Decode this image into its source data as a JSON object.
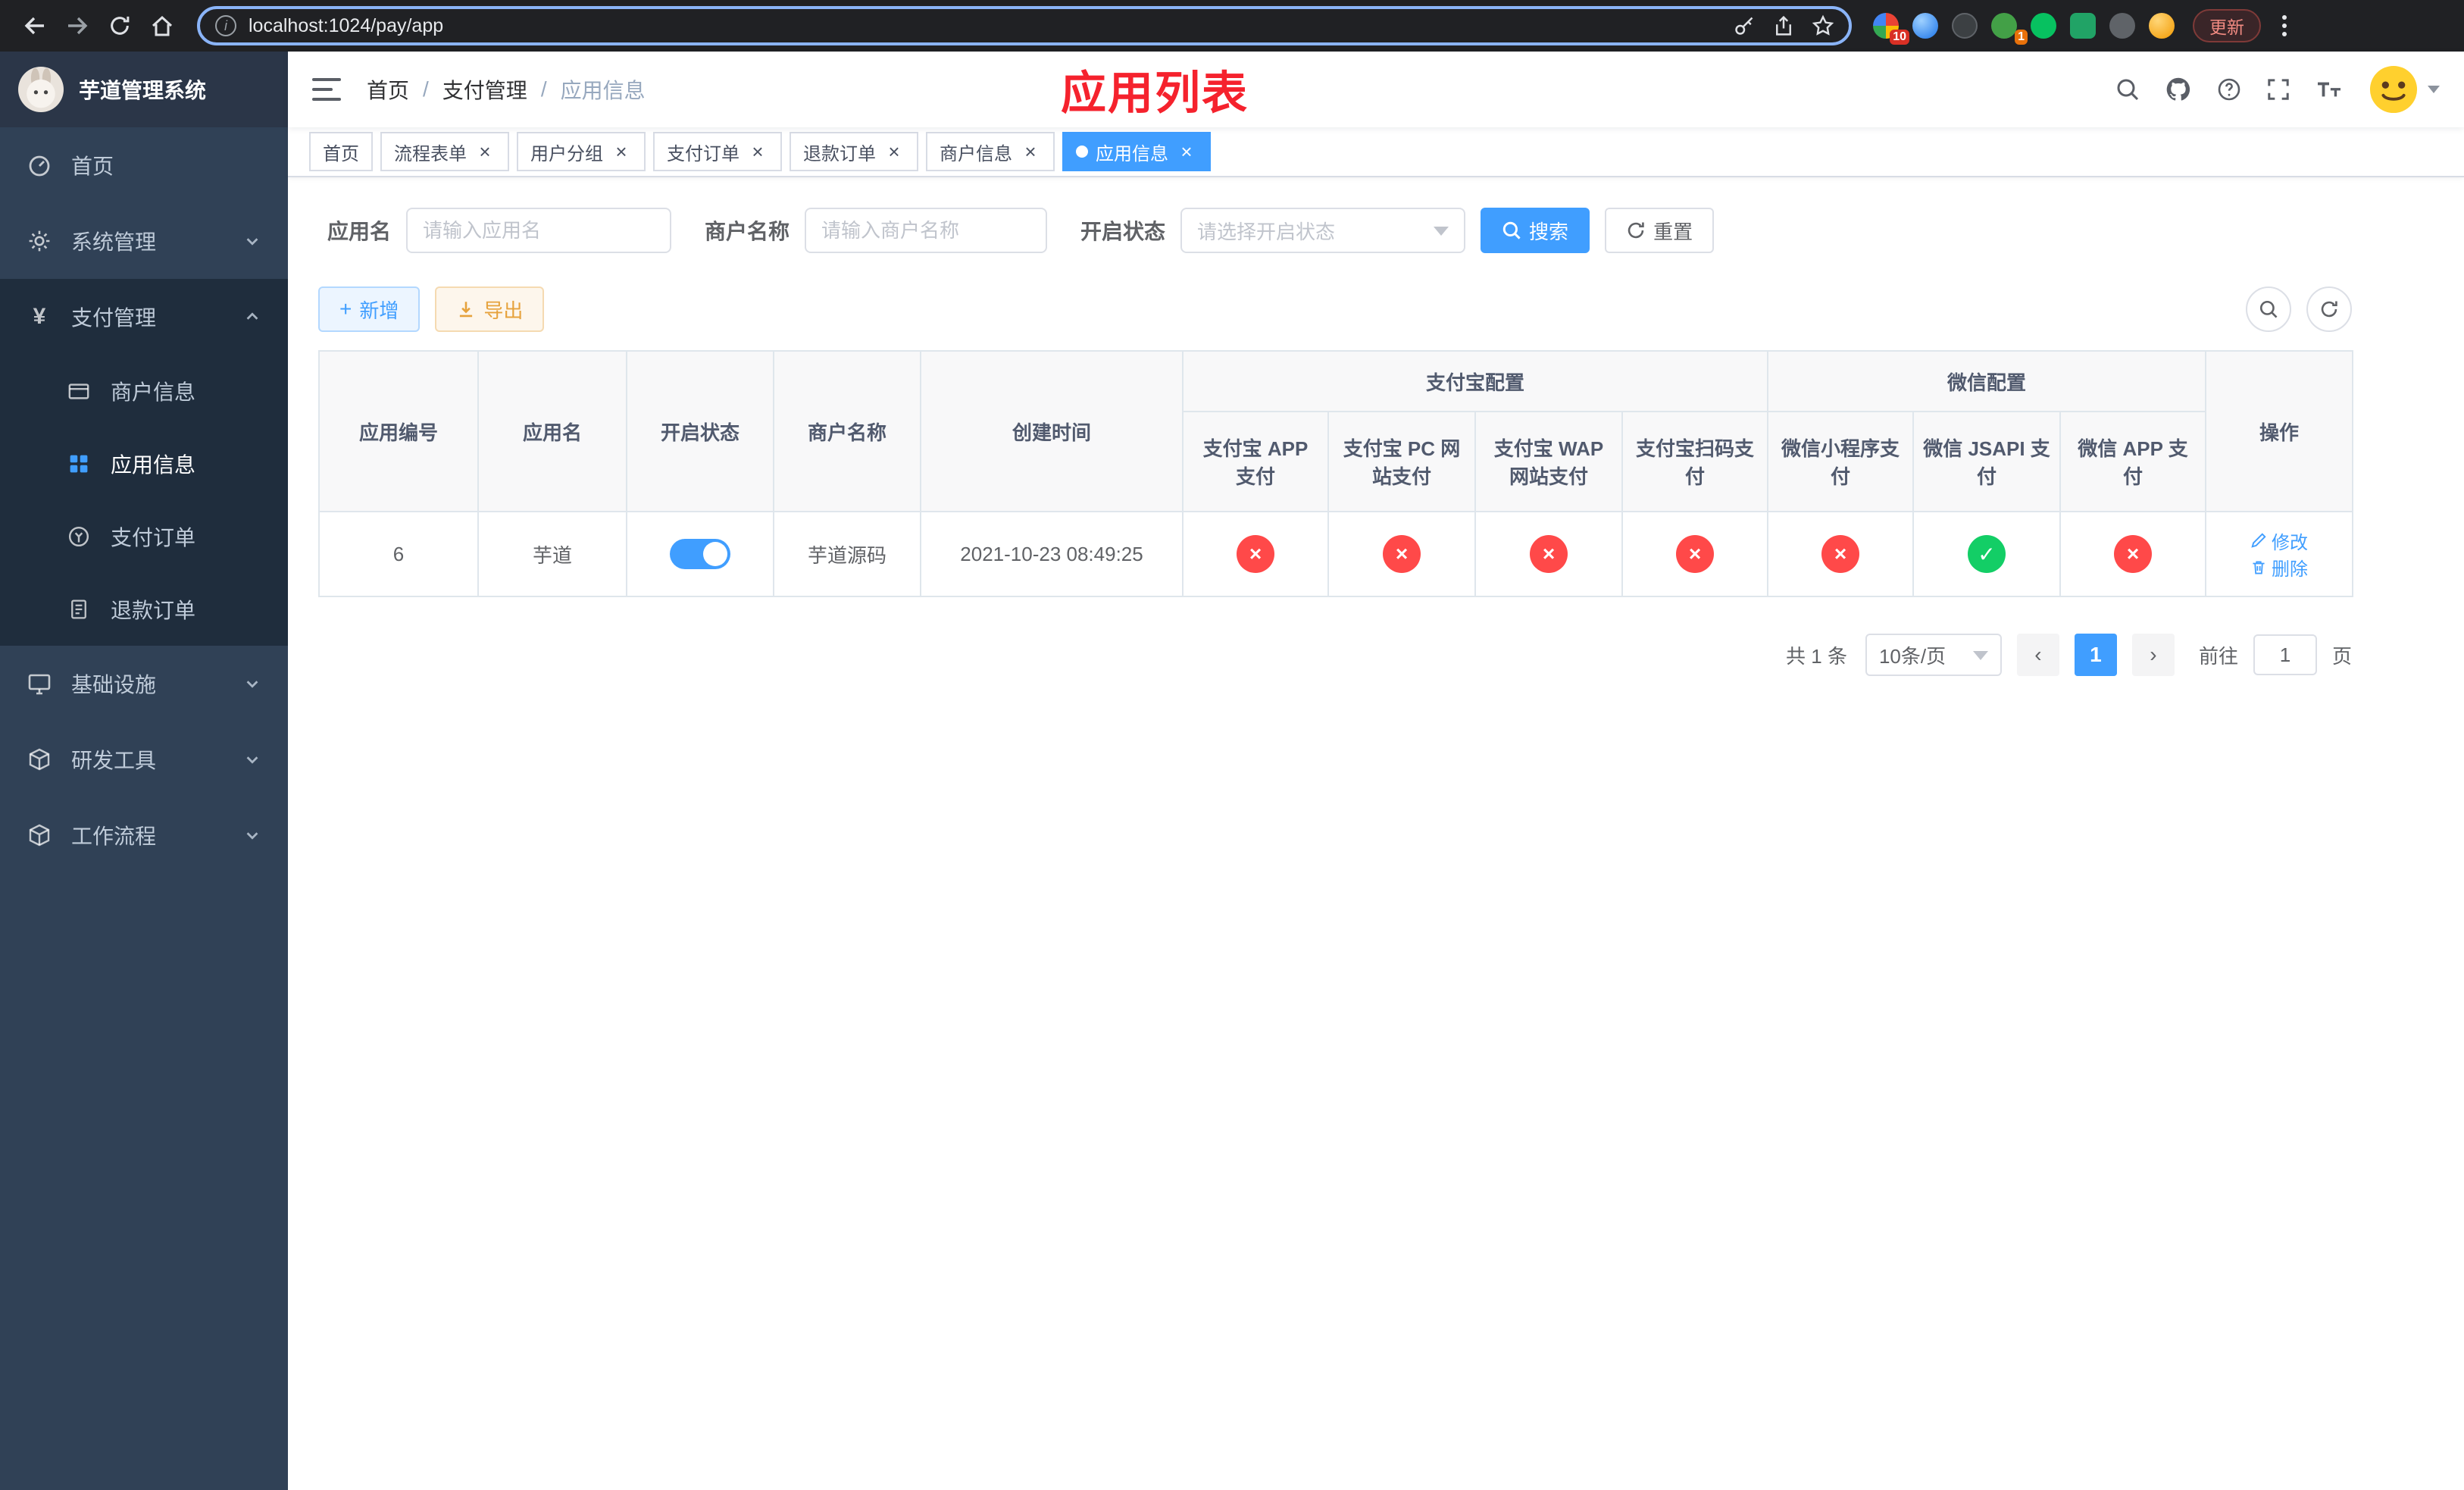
{
  "colors": {
    "accent": "#409eff",
    "success": "#13ce66",
    "danger": "#ff4949",
    "warning": "#e6a23c",
    "overlay_red": "#f5222d"
  },
  "browser": {
    "url": "localhost:1024/pay/app",
    "update_label": "更新",
    "ext_badge_photos": "10",
    "ext_badge_green": "1"
  },
  "sidebar": {
    "title": "芋道管理系统",
    "items": [
      {
        "label": "首页"
      },
      {
        "label": "系统管理"
      },
      {
        "label": "支付管理",
        "children": [
          {
            "label": "商户信息"
          },
          {
            "label": "应用信息"
          },
          {
            "label": "支付订单"
          },
          {
            "label": "退款订单"
          }
        ]
      },
      {
        "label": "基础设施"
      },
      {
        "label": "研发工具"
      },
      {
        "label": "工作流程"
      }
    ]
  },
  "header": {
    "breadcrumb": [
      "首页",
      "支付管理",
      "应用信息"
    ],
    "overlay_title": "应用列表"
  },
  "tabs": [
    {
      "label": "首页"
    },
    {
      "label": "流程表单"
    },
    {
      "label": "用户分组"
    },
    {
      "label": "支付订单"
    },
    {
      "label": "退款订单"
    },
    {
      "label": "商户信息"
    },
    {
      "label": "应用信息"
    }
  ],
  "filters": {
    "app_name_label": "应用名",
    "app_name_placeholder": "请输入应用名",
    "merchant_label": "商户名称",
    "merchant_placeholder": "请输入商户名称",
    "status_label": "开启状态",
    "status_placeholder": "请选择开启状态",
    "search_label": "搜索",
    "reset_label": "重置"
  },
  "toolbar": {
    "add_label": "新增",
    "export_label": "导出"
  },
  "table": {
    "header": {
      "app_id": "应用编号",
      "app_name": "应用名",
      "status": "开启状态",
      "merchant": "商户名称",
      "created": "创建时间",
      "alipay_group": "支付宝配置",
      "wechat_group": "微信配置",
      "alipay_app": "支付宝 APP 支付",
      "alipay_pc": "支付宝 PC 网站支付",
      "alipay_wap": "支付宝 WAP 网站支付",
      "alipay_qr": "支付宝扫码支付",
      "wx_mini": "微信小程序支付",
      "wx_jsapi": "微信 JSAPI 支付",
      "wx_app": "微信 APP 支付",
      "actions": "操作"
    },
    "rows": [
      {
        "id": "6",
        "name": "芋道",
        "status_on": true,
        "merchant": "芋道源码",
        "created": "2021-10-23 08:49:25",
        "configs": {
          "alipay_app": false,
          "alipay_pc": false,
          "alipay_wap": false,
          "alipay_qr": false,
          "wx_mini": false,
          "wx_jsapi": true,
          "wx_app": false
        },
        "edit_label": "修改",
        "delete_label": "删除"
      }
    ]
  },
  "pagination": {
    "total": "共 1 条",
    "page_size": "10条/页",
    "current_page": "1",
    "goto_label": "前往",
    "goto_value": "1",
    "goto_suffix": "页"
  }
}
